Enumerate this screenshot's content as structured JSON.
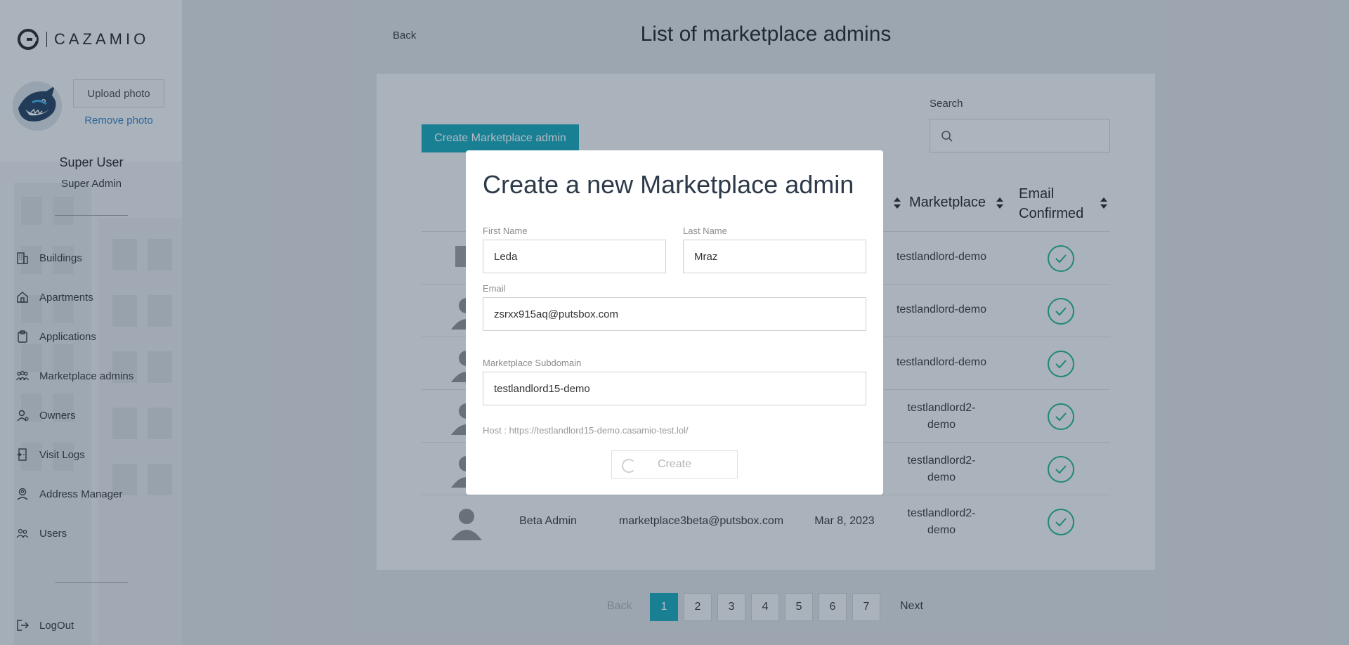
{
  "brand": {
    "name": "CAZAMIO"
  },
  "profile": {
    "upload_label": "Upload photo",
    "remove_label": "Remove photo",
    "name": "Super User",
    "role": "Super Admin"
  },
  "nav": [
    {
      "label": "Buildings",
      "icon": "building-icon"
    },
    {
      "label": "Apartments",
      "icon": "home-icon"
    },
    {
      "label": "Applications",
      "icon": "clipboard-icon"
    },
    {
      "label": "Marketplace admins",
      "icon": "group-icon"
    },
    {
      "label": "Owners",
      "icon": "owner-icon"
    },
    {
      "label": "Visit Logs",
      "icon": "door-icon"
    },
    {
      "label": "Address Manager",
      "icon": "location-person-icon"
    },
    {
      "label": "Users",
      "icon": "users-icon"
    }
  ],
  "logout_label": "LogOut",
  "header": {
    "back_label": "Back",
    "title": "List of marketplace admins"
  },
  "toolbar": {
    "create_label": "Create Marketplace admin",
    "search_label": "Search"
  },
  "table": {
    "col_marketplace": "Marketplace",
    "col_email_confirmed_1": "Email",
    "col_email_confirmed_2": "Confirmed",
    "rows": [
      {
        "marketplace": "testlandlord-demo",
        "confirmed": true
      },
      {
        "marketplace": "testlandlord-demo",
        "confirmed": true
      },
      {
        "marketplace": "testlandlord-demo",
        "confirmed": true
      },
      {
        "marketplace_1": "testlandlord2-",
        "marketplace_2": "demo",
        "confirmed": true
      },
      {
        "marketplace_1": "testlandlord2-",
        "marketplace_2": "demo",
        "confirmed": true
      },
      {
        "name": "Beta Admin",
        "email": "marketplace3beta@putsbox.com",
        "date": "Mar 8, 2023",
        "marketplace_1": "testlandlord2-",
        "marketplace_2": "demo",
        "confirmed": true
      }
    ]
  },
  "pagination": {
    "back_label": "Back",
    "next_label": "Next",
    "pages": [
      "1",
      "2",
      "3",
      "4",
      "5",
      "6",
      "7"
    ],
    "current": "1"
  },
  "modal": {
    "title": "Create a new Marketplace admin",
    "first_name_label": "First Name",
    "first_name_value": "Leda",
    "last_name_label": "Last Name",
    "last_name_value": "Mraz",
    "email_label": "Email",
    "email_value": "zsrxx915aq@putsbox.com",
    "subdomain_label": "Marketplace Subdomain",
    "subdomain_value": "testlandlord15-demo",
    "host_text": "Host : https://testlandlord15-demo.casamio-test.lol/",
    "create_label": "Create"
  },
  "colors": {
    "accent": "#12a6b8",
    "check": "#1ab28a",
    "link": "#2f7ec2"
  }
}
